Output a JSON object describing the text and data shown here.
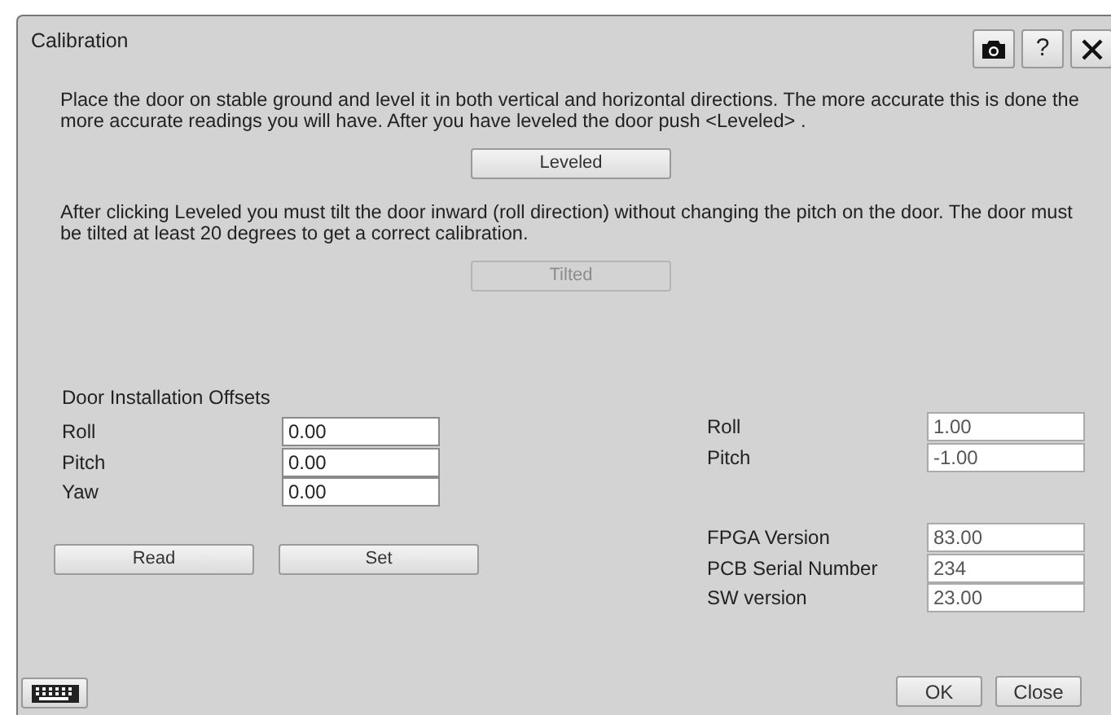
{
  "window": {
    "title": "Calibration"
  },
  "title_buttons": [
    {
      "kind": "camera"
    },
    {
      "kind": "help",
      "label": "?"
    },
    {
      "kind": "close"
    }
  ],
  "instructions": [
    {
      "text": "Place the door on stable ground and level it in both vertical and horizontal directions. The more accurate this is done the more accurate readings you will have. After you have leveled the door push <Leveled> .",
      "button": {
        "label": "Leveled",
        "disabled": false
      }
    },
    {
      "text": "After clicking Leveled you must tilt the door inward (roll direction) without changing the pitch on the door. The door must be tilted at least 20 degrees to get a correct calibration.",
      "button": {
        "label": "Tilted",
        "disabled": true
      }
    }
  ],
  "offsets": {
    "title": "Door Installation Offsets",
    "fields": [
      {
        "label": "Roll",
        "value": "0.00"
      },
      {
        "label": "Pitch",
        "value": "0.00"
      },
      {
        "label": "Yaw",
        "value": "0.00"
      }
    ],
    "buttons": [
      "Read",
      "Set"
    ]
  },
  "readings": [
    {
      "label": "Roll",
      "value": "1.00"
    },
    {
      "label": "Pitch",
      "value": "-1.00"
    }
  ],
  "versions": [
    {
      "label": "FPGA Version",
      "value": "83.00"
    },
    {
      "label": "PCB Serial Number",
      "value": "234"
    },
    {
      "label": "SW version",
      "value": "23.00"
    }
  ],
  "footer_buttons": [
    "OK",
    "Close"
  ]
}
